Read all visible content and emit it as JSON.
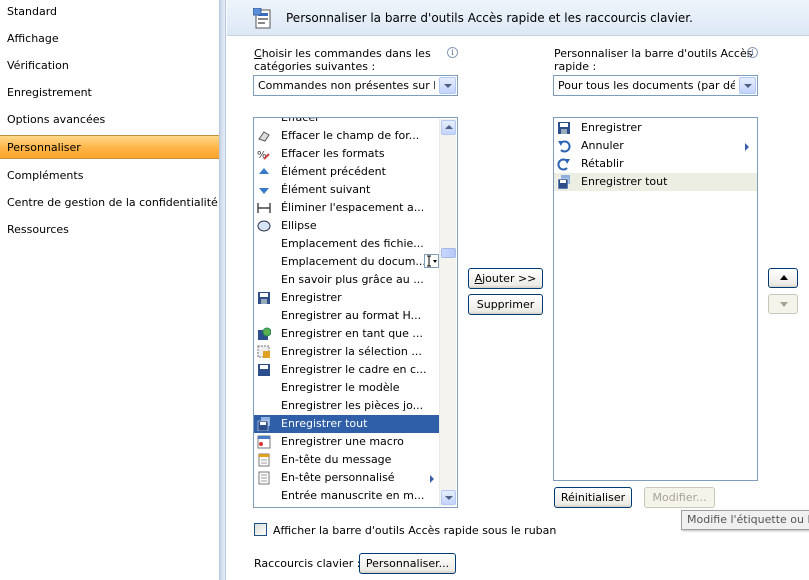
{
  "nav": {
    "items": [
      {
        "label": "Standard"
      },
      {
        "label": "Affichage"
      },
      {
        "label": "Vérification"
      },
      {
        "label": "Enregistrement"
      },
      {
        "label": "Options avancées"
      },
      {
        "label": "Personnaliser",
        "selected": true
      },
      {
        "label": "Compléments"
      },
      {
        "label": "Centre de gestion de la confidentialité"
      },
      {
        "label": "Ressources"
      }
    ]
  },
  "header": {
    "title": "Personnaliser la barre d'outils Accès rapide et les raccourcis clavier."
  },
  "left_panel": {
    "label": "Choisir les commandes dans les catégories suivantes :",
    "label_line1": "Choisir les commandes dans les",
    "label_line2": "catégories suivantes :",
    "combo_value": "Commandes non présentes sur l...",
    "list_partial_top": "Effacer",
    "list": [
      {
        "label": "Effacer le champ de for...",
        "icon": "eraser-icon"
      },
      {
        "label": "Effacer les formats",
        "icon": "clear-formats-icon"
      },
      {
        "label": "Élément précédent",
        "icon": "arrow-up-icon"
      },
      {
        "label": "Élément suivant",
        "icon": "arrow-down-icon"
      },
      {
        "label": "Éliminer l'espacement a...",
        "icon": "spacing-icon"
      },
      {
        "label": "Ellipse",
        "icon": "ellipse-icon"
      },
      {
        "label": "Emplacement des fichie...",
        "icon": ""
      },
      {
        "label": "Emplacement du docum...",
        "icon": ""
      },
      {
        "label": "En savoir plus grâce au ...",
        "icon": ""
      },
      {
        "label": "Enregistrer",
        "icon": "save-icon"
      },
      {
        "label": "Enregistrer au format H...",
        "icon": ""
      },
      {
        "label": "Enregistrer en tant que ...",
        "icon": "save-as-icon"
      },
      {
        "label": "Enregistrer la sélection ...",
        "icon": "save-selection-icon"
      },
      {
        "label": "Enregistrer le cadre en c...",
        "icon": "save-frame-icon"
      },
      {
        "label": "Enregistrer le modèle",
        "icon": ""
      },
      {
        "label": "Enregistrer les pièces jo...",
        "icon": ""
      },
      {
        "label": "Enregistrer tout",
        "icon": "save-all-icon",
        "selected": true
      },
      {
        "label": "Enregistrer une macro",
        "icon": "record-macro-icon"
      },
      {
        "label": "En-tête du message",
        "icon": "message-header-icon"
      },
      {
        "label": "En-tête personnalisé",
        "icon": "custom-header-icon",
        "submenu": true
      },
      {
        "label": "Entrée manuscrite en m...",
        "icon": ""
      }
    ]
  },
  "middle": {
    "add_label": "Ajouter >>",
    "add_underline": "A",
    "add_rest": "jouter >>",
    "remove_label": "Supprimer"
  },
  "right_panel": {
    "label_line1": "Personnaliser la barre d'outils Accès",
    "label_line2": "rapide :",
    "combo_value": "Pour tous les documents (par dé...",
    "list": [
      {
        "label": "Enregistrer",
        "icon": "save-icon"
      },
      {
        "label": "Annuler",
        "icon": "undo-icon",
        "submenu": true
      },
      {
        "label": "Rétablir",
        "icon": "redo-icon"
      },
      {
        "label": "Enregistrer tout",
        "icon": "save-all-icon",
        "highlighted": true
      }
    ],
    "reset_label": "Réinitialiser",
    "modify_label": "Modifier..."
  },
  "footer": {
    "checkbox_label": "Afficher la barre d'outils Accès rapide sous le ruban",
    "shortcut_label": "Raccourcis clavier :",
    "customize_button": "Personnaliser..."
  },
  "tooltip": {
    "text": "Modifie l'étiquette ou l'i"
  },
  "colors": {
    "selection": "#2f5fa8",
    "nav_selected": "#ffb447",
    "header_bg": "#dde8f5"
  }
}
